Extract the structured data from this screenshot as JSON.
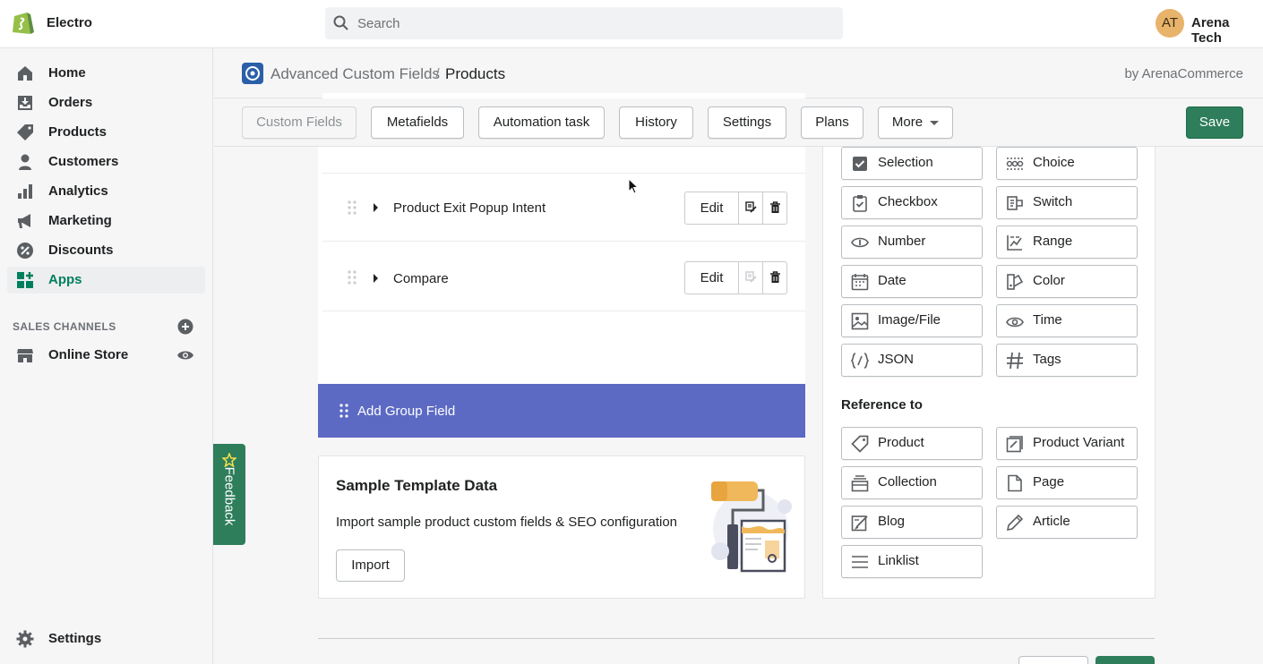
{
  "topbar": {
    "store_name": "Electro",
    "search_placeholder": "Search",
    "avatar_initials": "AT",
    "user_name": "Arena Tech"
  },
  "sidebar": {
    "items": [
      {
        "label": "Home",
        "icon": "home-icon"
      },
      {
        "label": "Orders",
        "icon": "orders-icon"
      },
      {
        "label": "Products",
        "icon": "tag-icon"
      },
      {
        "label": "Customers",
        "icon": "person-icon"
      },
      {
        "label": "Analytics",
        "icon": "bar-chart-icon"
      },
      {
        "label": "Marketing",
        "icon": "megaphone-icon"
      },
      {
        "label": "Discounts",
        "icon": "discount-icon"
      },
      {
        "label": "Apps",
        "icon": "apps-icon",
        "active": true
      }
    ],
    "sales_channels_header": "SALES CHANNELS",
    "online_store": "Online Store",
    "settings": "Settings"
  },
  "app_header": {
    "app_name": "Advanced Custom Fields",
    "separator": "/",
    "page": "Products",
    "byline": "by ArenaCommerce"
  },
  "toolbar": {
    "tabs": [
      "Custom Fields",
      "Metafields",
      "Automation task",
      "History",
      "Settings",
      "Plans",
      "More"
    ],
    "save_label": "Save"
  },
  "fields": {
    "rows": [
      {
        "name": "Product Exit Popup Intent",
        "edit": "Edit"
      },
      {
        "name": "Compare",
        "edit": "Edit"
      }
    ],
    "add_group": "Add Group Field"
  },
  "sample": {
    "title": "Sample Template Data",
    "description": "Import sample product custom fields & SEO configuration",
    "import_label": "Import"
  },
  "types": {
    "basic": [
      {
        "label": "Selection",
        "icon": "checkbox-checked-icon"
      },
      {
        "label": "Choice",
        "icon": "choice-icon"
      },
      {
        "label": "Checkbox",
        "icon": "clipboard-check-icon"
      },
      {
        "label": "Switch",
        "icon": "switch-icon"
      },
      {
        "label": "Number",
        "icon": "number-icon"
      },
      {
        "label": "Range",
        "icon": "range-icon"
      },
      {
        "label": "Date",
        "icon": "calendar-icon"
      },
      {
        "label": "Color",
        "icon": "color-icon"
      },
      {
        "label": "Image/File",
        "icon": "image-icon"
      },
      {
        "label": "Time",
        "icon": "time-icon"
      },
      {
        "label": "JSON",
        "icon": "json-icon"
      },
      {
        "label": "Tags",
        "icon": "hash-icon"
      }
    ],
    "reference_heading": "Reference to",
    "reference": [
      {
        "label": "Product",
        "icon": "tag-icon"
      },
      {
        "label": "Product Variant",
        "icon": "variant-icon"
      },
      {
        "label": "Collection",
        "icon": "collection-icon"
      },
      {
        "label": "Page",
        "icon": "page-icon"
      },
      {
        "label": "Blog",
        "icon": "blog-icon"
      },
      {
        "label": "Article",
        "icon": "pen-icon"
      },
      {
        "label": "Linklist",
        "icon": "list-icon"
      }
    ]
  },
  "feedback": {
    "label": "Feedback"
  },
  "colors": {
    "primary": "#2e7d5b",
    "accent": "#5c6ac4",
    "active_nav": "#007f5f"
  }
}
